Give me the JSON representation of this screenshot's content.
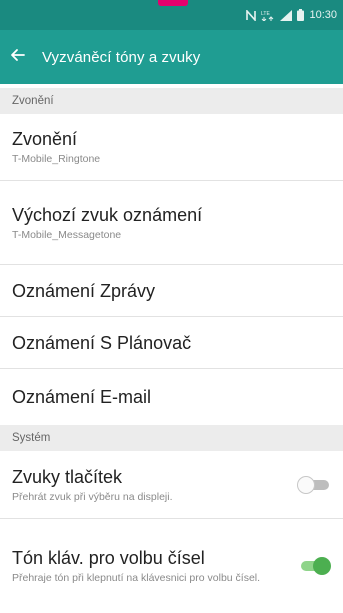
{
  "status_bar": {
    "time": "10:30",
    "icons": [
      "nfc-icon",
      "lte-icon",
      "signal-icon",
      "battery-icon"
    ],
    "lte_text": "LTE"
  },
  "app_bar": {
    "back_icon": "arrow-left-icon",
    "title": "Vyzváněcí tóny a zvuky"
  },
  "sections": {
    "ringing_header": "Zvonění",
    "system_header": "Systém"
  },
  "items": [
    {
      "title": "Zvonění",
      "subtitle": "T-Mobile_Ringtone"
    },
    {
      "title": "Výchozí zvuk oznámení",
      "subtitle": "T-Mobile_Messagetone"
    },
    {
      "title": "Oznámení Zprávy"
    },
    {
      "title": "Oznámení S Plánovač"
    },
    {
      "title": "Oznámení E-mail"
    }
  ],
  "system_items": [
    {
      "title": "Zvuky tlačítek",
      "subtitle": "Přehrát zvuk při výběru na displeji.",
      "toggle": "off"
    },
    {
      "title": "Tón kláv. pro volbu čísel",
      "subtitle": "Přehraje tón při klepnutí na klávesnici pro volbu čísel.",
      "toggle": "on"
    }
  ],
  "colors": {
    "accent": "#1f9d92",
    "status_bar": "#1a8a80",
    "toggle_on": "#4caf50",
    "marker": "#e5006d"
  }
}
